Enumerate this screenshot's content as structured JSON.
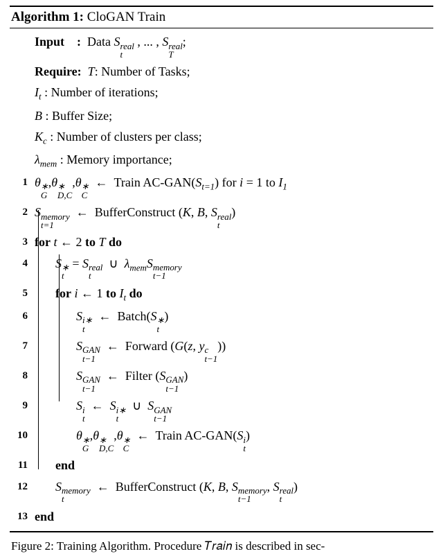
{
  "alg": {
    "title_prefix": "Algorithm 1:",
    "title_name": "CloGAN Train",
    "input_label": "Input",
    "input_colon": ":",
    "require_label": "Require:",
    "caption": "Figure 2: Training Algorithm. Procedure 𝑇𝑟𝑎𝑖𝑛 is described in sec-"
  },
  "symbols": {
    "S": "S",
    "t": "t",
    "T": "T",
    "real": "real",
    "memory": "memory",
    "GAN": "GAN",
    "I": "I",
    "It": "I",
    "B": "B",
    "K": "K",
    "Kc": "K",
    "c": "c",
    "lambda": "λ",
    "mem": "mem",
    "thetaG": "θ",
    "thetaDC": "θ",
    "thetaC": "θ",
    "G": "G",
    "D": "D",
    "C": "C",
    "z": "z",
    "y": "y",
    "i": "i",
    "star": "∗",
    "arrow": "←",
    "cup": "∪",
    "forkw": "for",
    "tokw": "to",
    "dokw": "do",
    "endkw": "end"
  },
  "descr": {
    "input_data": "Data ",
    "TNumTasks": ": Number of Tasks;",
    "ItNumIter": " : Number of iterations;",
    "BBuffer": " : Buffer Size;",
    "KcClusters": " : Number of clusters per class;",
    "lambdaMem": " : Memory importance;",
    "trainAC": "Train AC-GAN",
    "bufferConstruct": "BufferConstruct",
    "batch": "Batch",
    "forward": "Forward",
    "filter": "Filter",
    "for_i_eq": "for ",
    "eq1": " = 1 to ",
    "dots": ", ... ,"
  },
  "lines": {
    "l1_for_range": " for ",
    "eq1to": " = 1 to ",
    "I1": "I",
    "one": "1"
  }
}
